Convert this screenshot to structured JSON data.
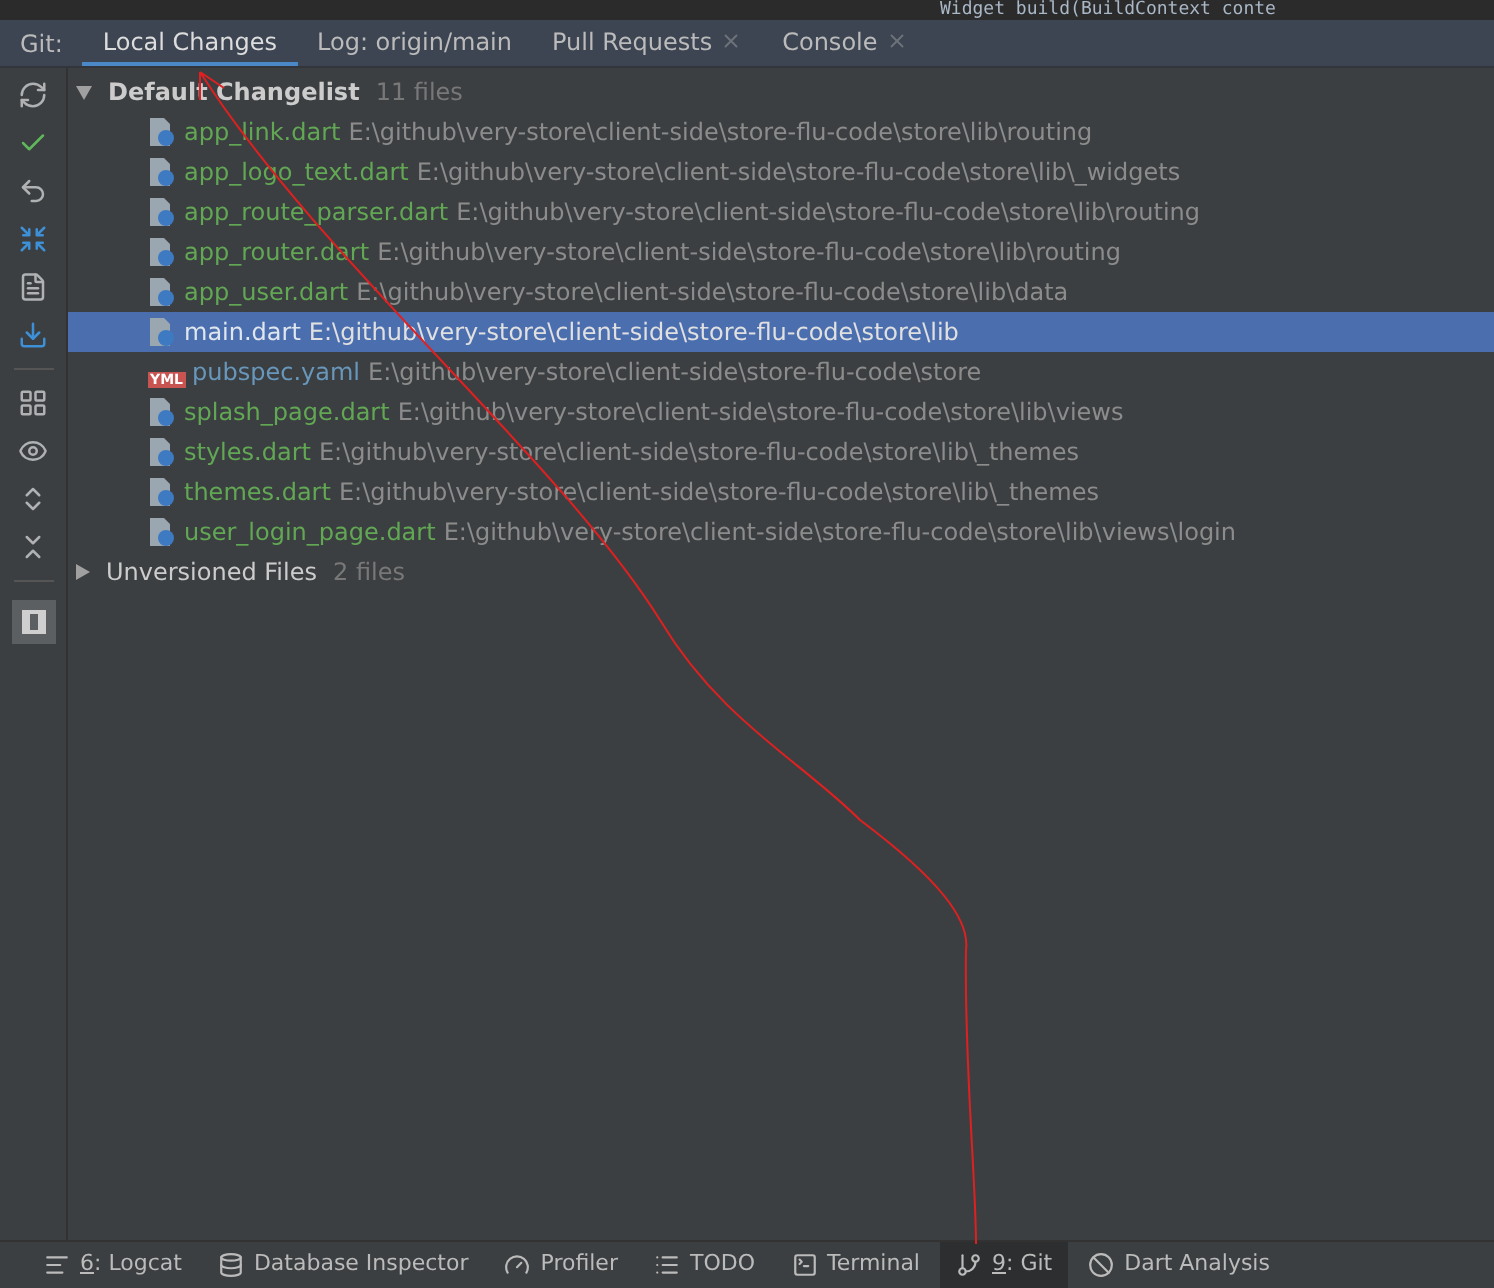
{
  "editor_line": "Widget build(BuildContext conte",
  "tool_window": {
    "label": "Git:",
    "tabs": [
      {
        "label": "Local Changes",
        "selected": true,
        "closable": false
      },
      {
        "label": "Log: origin/main",
        "selected": false,
        "closable": false
      },
      {
        "label": "Pull Requests",
        "selected": false,
        "closable": true
      },
      {
        "label": "Console",
        "selected": false,
        "closable": true
      }
    ]
  },
  "changelists": [
    {
      "name": "Default Changelist",
      "count": "11 files",
      "expanded": true,
      "files": [
        {
          "name": "app_link.dart",
          "path": "E:\\github\\very-store\\client-side\\store-flu-code\\store\\lib\\routing",
          "color": "#62a854",
          "kind": "dart",
          "selected": false
        },
        {
          "name": "app_logo_text.dart",
          "path": "E:\\github\\very-store\\client-side\\store-flu-code\\store\\lib\\_widgets",
          "color": "#62a854",
          "kind": "dart",
          "selected": false
        },
        {
          "name": "app_route_parser.dart",
          "path": "E:\\github\\very-store\\client-side\\store-flu-code\\store\\lib\\routing",
          "color": "#62a854",
          "kind": "dart",
          "selected": false
        },
        {
          "name": "app_router.dart",
          "path": "E:\\github\\very-store\\client-side\\store-flu-code\\store\\lib\\routing",
          "color": "#62a854",
          "kind": "dart",
          "selected": false
        },
        {
          "name": "app_user.dart",
          "path": "E:\\github\\very-store\\client-side\\store-flu-code\\store\\lib\\data",
          "color": "#62a854",
          "kind": "dart",
          "selected": false
        },
        {
          "name": "main.dart",
          "path": "E:\\github\\very-store\\client-side\\store-flu-code\\store\\lib",
          "color": "#dfe6ee",
          "kind": "dart",
          "selected": true
        },
        {
          "name": "pubspec.yaml",
          "path": "E:\\github\\very-store\\client-side\\store-flu-code\\store",
          "color": "#6897bb",
          "kind": "yaml",
          "selected": false
        },
        {
          "name": "splash_page.dart",
          "path": "E:\\github\\very-store\\client-side\\store-flu-code\\store\\lib\\views",
          "color": "#62a854",
          "kind": "dart",
          "selected": false
        },
        {
          "name": "styles.dart",
          "path": "E:\\github\\very-store\\client-side\\store-flu-code\\store\\lib\\_themes",
          "color": "#62a854",
          "kind": "dart",
          "selected": false
        },
        {
          "name": "themes.dart",
          "path": "E:\\github\\very-store\\client-side\\store-flu-code\\store\\lib\\_themes",
          "color": "#62a854",
          "kind": "dart",
          "selected": false
        },
        {
          "name": "user_login_page.dart",
          "path": "E:\\github\\very-store\\client-side\\store-flu-code\\store\\lib\\views\\login",
          "color": "#62a854",
          "kind": "dart",
          "selected": false
        }
      ]
    },
    {
      "name": "Unversioned Files",
      "count": "2 files",
      "expanded": false
    }
  ],
  "yaml_badge": "YML",
  "bottom_bar": [
    {
      "kind": "logcat",
      "mnemonic": "6",
      "label": ": Logcat",
      "selected": false
    },
    {
      "kind": "database",
      "label": "Database Inspector",
      "selected": false
    },
    {
      "kind": "profiler",
      "label": "Profiler",
      "selected": false
    },
    {
      "kind": "todo",
      "label": "TODO",
      "selected": false
    },
    {
      "kind": "terminal",
      "label": "Terminal",
      "selected": false
    },
    {
      "kind": "git",
      "mnemonic": "9",
      "label": ": Git",
      "selected": true
    },
    {
      "kind": "dart",
      "label": "Dart Analysis",
      "selected": false
    }
  ]
}
